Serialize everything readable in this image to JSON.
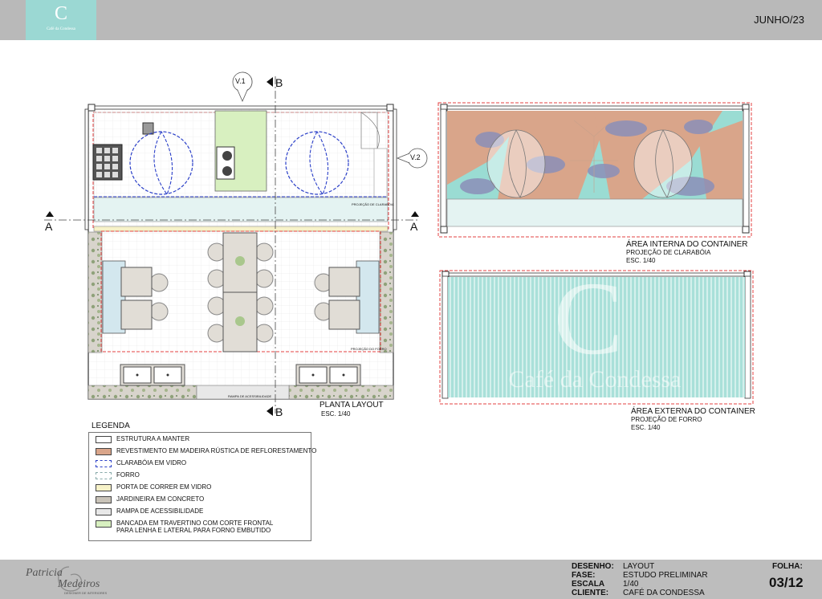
{
  "header": {
    "logo_letter": "C",
    "logo_caption": "Café da Condessa",
    "date": "JUNHO/23"
  },
  "plan": {
    "cut_v1": "V.1",
    "cut_v2": "V.2",
    "section_b_top": "B",
    "section_b_bottom": "B",
    "section_a_left": "A",
    "section_a_right": "A",
    "note_skylight": "PROJEÇÃO DE CLARABÓIA",
    "note_ramp": "RAMPA DE ACESSIBILIDADE",
    "note_grid": "PROJEÇÃO DO FORRO",
    "title": "PLANTA LAYOUT",
    "scale": "ESC. 1/40"
  },
  "internal_view": {
    "title": "ÁREA INTERNA DO CONTAINER",
    "subtitle": "PROJEÇÃO DE CLARABÓIA",
    "scale": "ESC. 1/40"
  },
  "external_view": {
    "title": "ÁREA EXTERNA DO CONTAINER",
    "subtitle": "PROJEÇÃO DE FORRO",
    "scale": "ESC. 1/40",
    "watermark_letter": "C",
    "watermark_text": "Café da Condessa"
  },
  "legend": {
    "title": "LEGENDA",
    "items": [
      {
        "label": "ESTRUTURA A MANTER",
        "color": "#ffffff",
        "style": "solid"
      },
      {
        "label": "REVESTIMENTO EM MADEIRA RÚSTICA DE REFLORESTAMENTO",
        "color": "#d9a58a",
        "style": "solid"
      },
      {
        "label": "CLARABÓIA EM VIDRO",
        "color": "#ffffff",
        "style": "blue-dashed"
      },
      {
        "label": "FORRO",
        "color": "#ffffff",
        "style": "grey-dashed"
      },
      {
        "label": "PORTA DE CORRER EM VIDRO",
        "color": "#f7f2c8",
        "style": "solid"
      },
      {
        "label": "JARDINEIRA EM CONCRETO",
        "color": "#c9c3b8",
        "style": "solid"
      },
      {
        "label": "RAMPA DE ACESSIBILIDADE",
        "color": "#e8e8e8",
        "style": "solid"
      },
      {
        "label": "BANCADA EM TRAVERTINO COM CORTE FRONTAL\nPARA LENHA E LATERAL PARA FORNO EMBUTIDO",
        "color": "#d8f0c0",
        "style": "solid"
      }
    ]
  },
  "footer": {
    "designer_name_1": "Patricia",
    "designer_name_2": "Medeiros",
    "designer_caption": "DESIGNER DE INTERIORES",
    "labels": [
      "DESENHO:",
      "FASE:",
      "ESCALA",
      "CLIENTE:"
    ],
    "values": [
      "LAYOUT",
      "ESTUDO PRELIMINAR",
      "1/40",
      "CAFÉ DA CONDESSA"
    ],
    "sheet_label": "FOLHA:",
    "sheet_value": "03/12"
  },
  "colors": {
    "header_bar": "#b9b9b9",
    "logo_teal": "#9bd8d3",
    "wood": "#d9a58a",
    "teal": "#9adcd3",
    "red_dash": "#e34040",
    "blue_dash": "#2a3fc8"
  }
}
